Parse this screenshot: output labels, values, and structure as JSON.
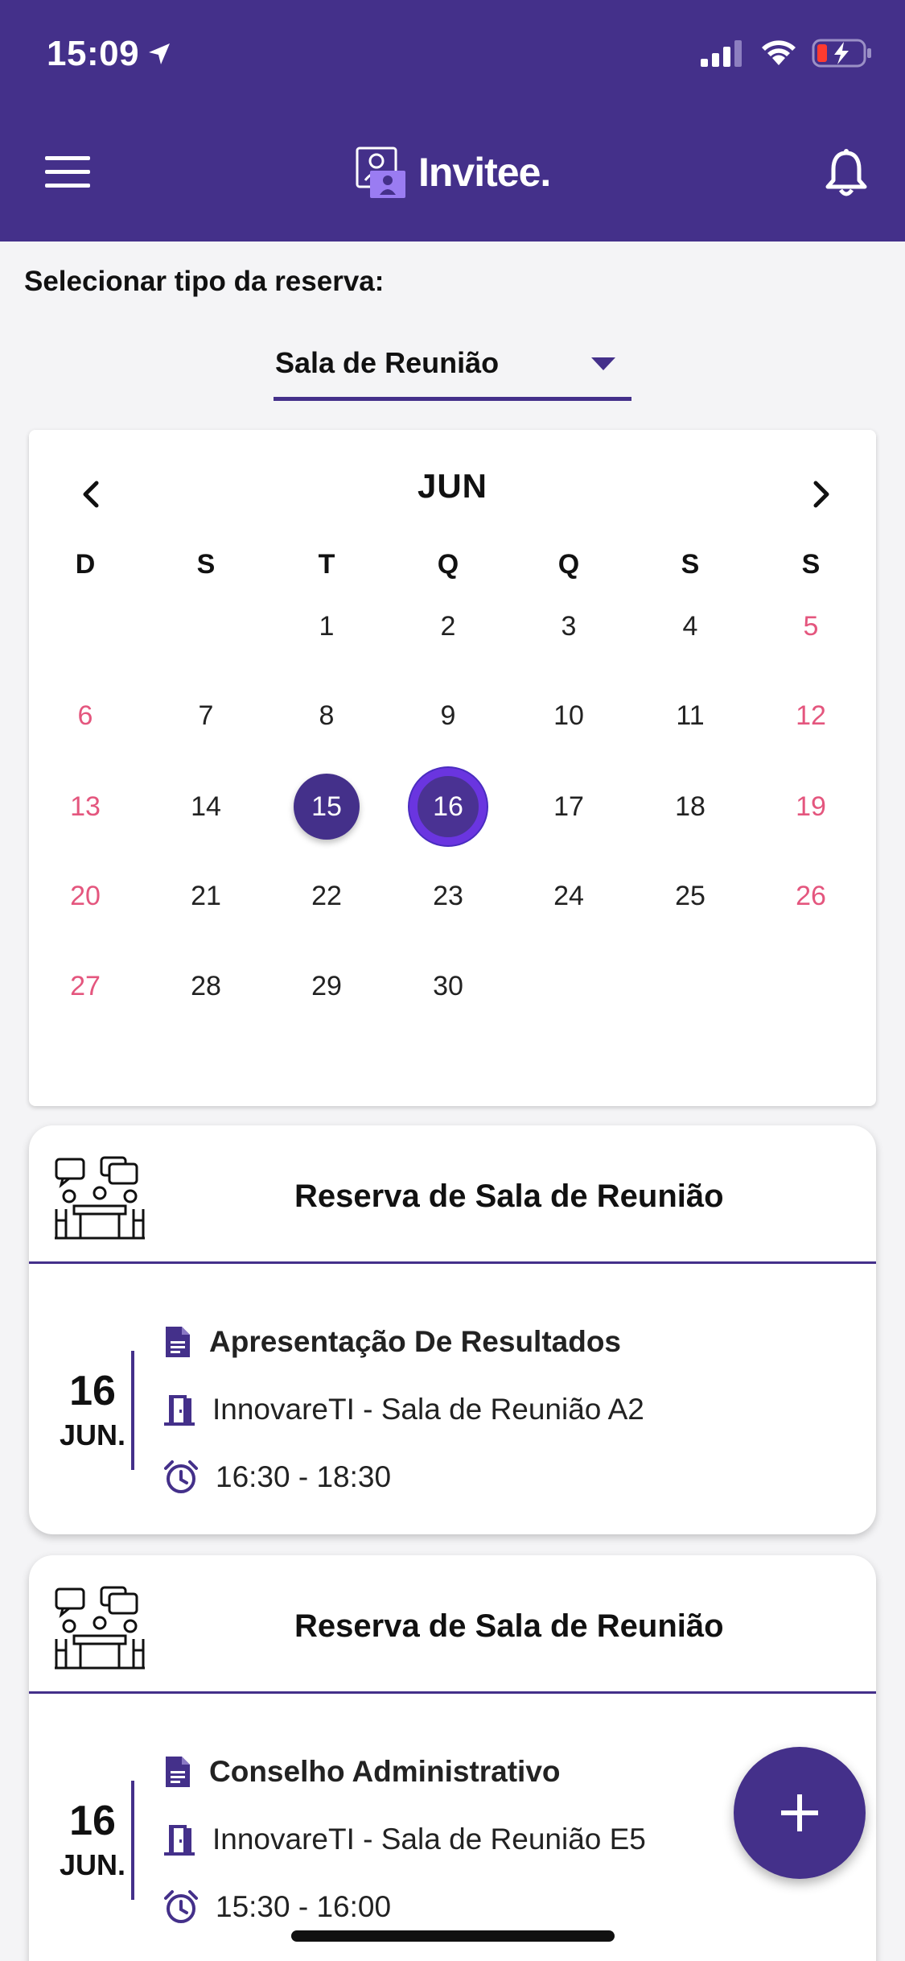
{
  "status_bar": {
    "time": "15:09"
  },
  "header": {
    "app_name": "Invitee."
  },
  "booking_type": {
    "label": "Selecionar tipo da reserva:",
    "selected": "Sala de Reunião"
  },
  "calendar": {
    "month": "JUN",
    "weekdays": [
      "D",
      "S",
      "T",
      "Q",
      "Q",
      "S",
      "S"
    ],
    "weeks": [
      [
        "",
        "",
        "1",
        "2",
        "3",
        "4",
        "5"
      ],
      [
        "6",
        "7",
        "8",
        "9",
        "10",
        "11",
        "12"
      ],
      [
        "13",
        "14",
        "15",
        "16",
        "17",
        "18",
        "19"
      ],
      [
        "20",
        "21",
        "22",
        "23",
        "24",
        "25",
        "26"
      ],
      [
        "27",
        "28",
        "29",
        "30",
        "",
        "",
        ""
      ]
    ],
    "selected_day": "15",
    "today": "16",
    "weekend_color": "#e4567e"
  },
  "reservations": [
    {
      "title": "Reserva de Sala de Reunião",
      "day": "16",
      "month": "JUN.",
      "event": "Apresentação De Resultados",
      "room": "InnovareTI - Sala de Reunião A2",
      "time": "16:30 - 18:30"
    },
    {
      "title": "Reserva de Sala de Reunião",
      "day": "16",
      "month": "JUN.",
      "event": "Conselho Administrativo",
      "room": "InnovareTI - Sala de Reunião E5",
      "time": "15:30 - 16:00"
    }
  ],
  "theme": {
    "primary": "#44308a",
    "accent": "#6a35e0"
  },
  "icons": {
    "menu": "hamburger-icon",
    "notifications": "bell-icon",
    "event": "document-icon",
    "room": "door-icon",
    "time": "alarm-icon",
    "add": "plus-icon"
  }
}
